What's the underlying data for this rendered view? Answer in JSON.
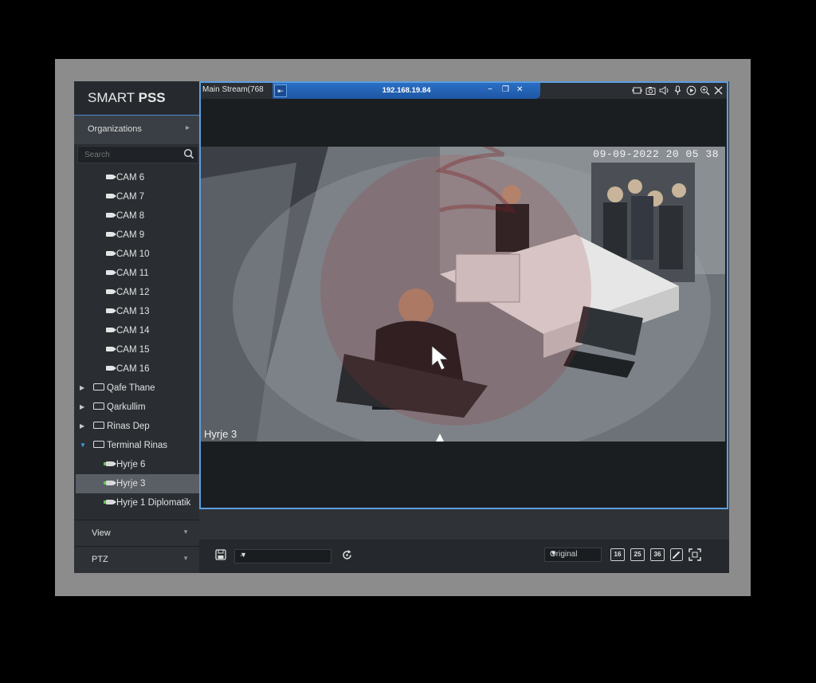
{
  "app": {
    "brand_light": "SMART ",
    "brand_bold": "PSS"
  },
  "sidebar": {
    "organizations_label": "Organizations",
    "search_placeholder": "Search",
    "cameras": [
      "CAM 6",
      "CAM 7",
      "CAM 8",
      "CAM 9",
      "CAM 10",
      "CAM 11",
      "CAM 12",
      "CAM 13",
      "CAM 14",
      "CAM 15",
      "CAM 16"
    ],
    "groups": [
      "Qafe Thane",
      "Qarkullim",
      "Rinas Dep"
    ],
    "open_group": "Terminal Rinas",
    "sub_items": [
      "Hyrje 6",
      "Hyrje 3",
      "Hyrje 1 Diplomatik"
    ],
    "selected_item": "Hyrje 3",
    "view_label": "View",
    "ptz_label": "PTZ"
  },
  "video": {
    "stream_label": "Main Stream(768",
    "ip": "192.168.19.84",
    "timestamp": "09-09-2022 20 05 38",
    "camera_name": "Hyrje 3"
  },
  "controls": {
    "preset_value": "--",
    "ratio_value": "Original",
    "grid_buttons": [
      "16",
      "25",
      "36"
    ]
  },
  "colors": {
    "accent": "#4b8ccd",
    "title_bar": "#2167b8",
    "online": "#5cc84e"
  }
}
